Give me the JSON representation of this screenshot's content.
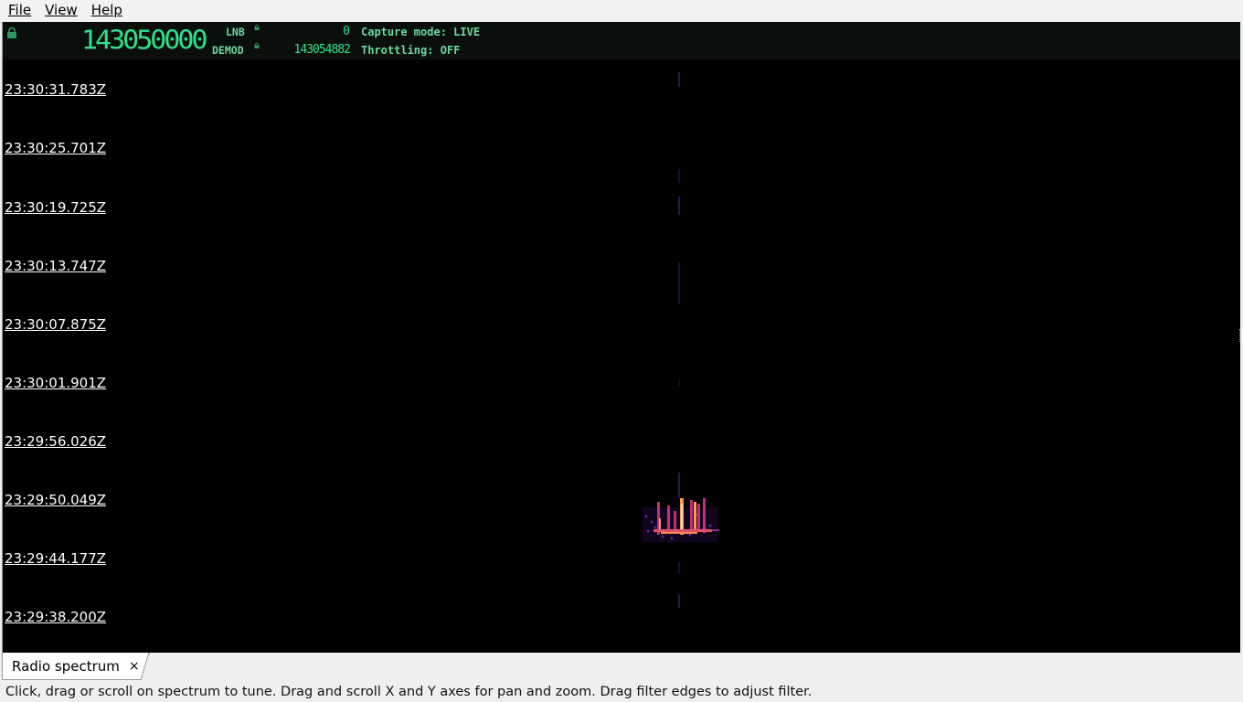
{
  "menu": {
    "file": "File",
    "view": "View",
    "help": "Help"
  },
  "header": {
    "main_frequency": "143050000",
    "lnb_label": "LNB",
    "lnb_value": "0",
    "demod_label": "DEMOD",
    "demod_value": "143054882",
    "capture_mode": "Capture mode: LIVE",
    "throttling": "Throttling: OFF",
    "readout_color": "#2fe08c"
  },
  "waterfall": {
    "timestamps": [
      "23:30:31.783Z",
      "23:30:25.701Z",
      "23:30:19.725Z",
      "23:30:13.747Z",
      "23:30:07.875Z",
      "23:30:01.901Z",
      "23:29:56.026Z",
      "23:29:50.049Z",
      "23:29:44.177Z",
      "23:29:38.200Z"
    ]
  },
  "tabs": [
    {
      "label": "Radio spectrum",
      "close": "×"
    }
  ],
  "statusbar": {
    "hint": "Click, drag or scroll on spectrum to tune. Drag and scroll X and Y axes for pan and zoom. Drag filter edges to adjust filter."
  }
}
